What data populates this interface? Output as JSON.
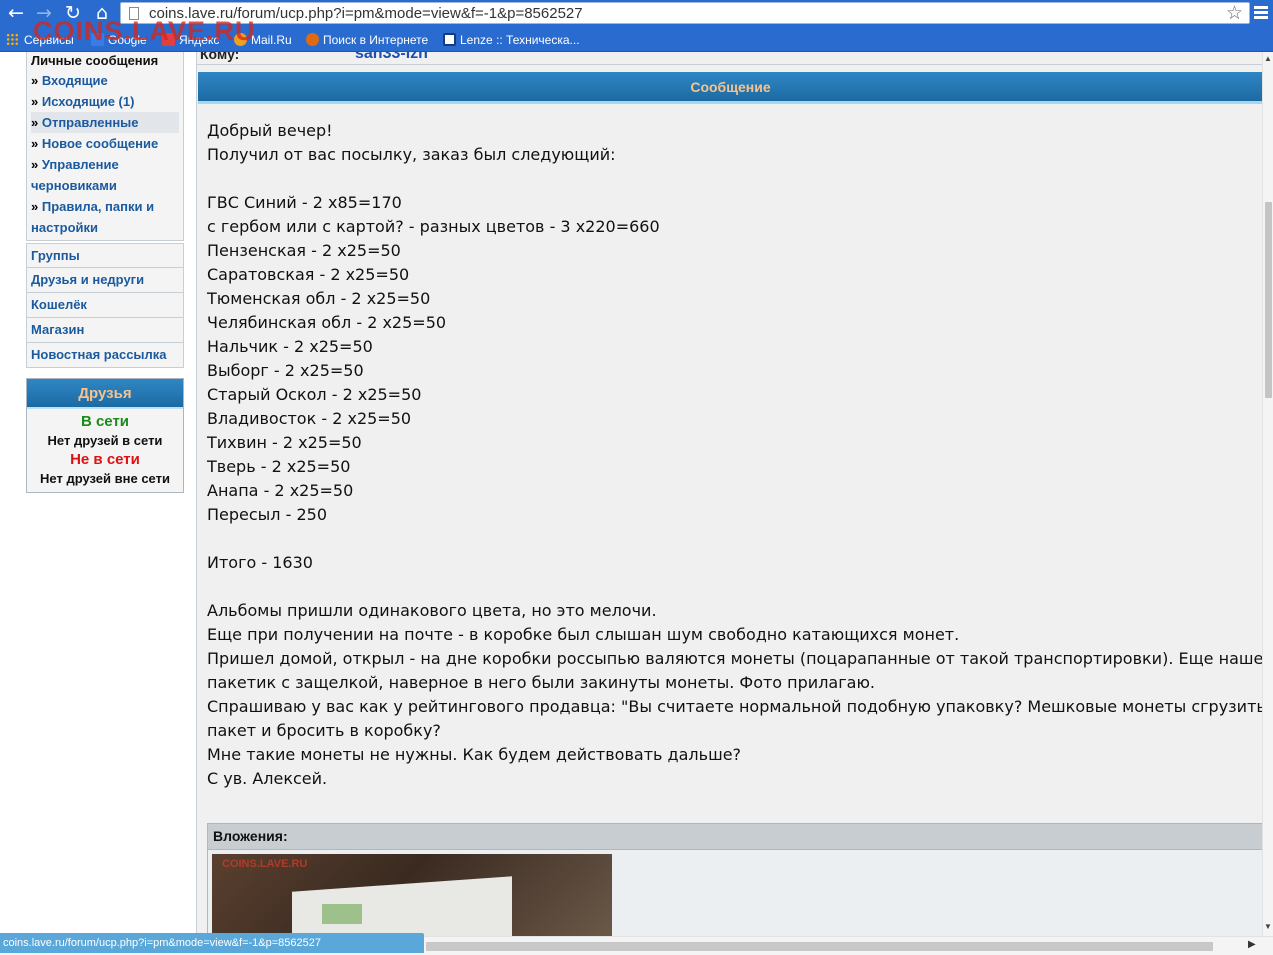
{
  "browser": {
    "url": "coins.lave.ru/forum/ucp.php?i=pm&mode=view&f=-1&p=8562527",
    "back_icon": "←",
    "forward_icon": "→",
    "reload_icon": "↻",
    "home_icon": "⌂",
    "star_icon": "☆",
    "watermark": "COINS.LAVE.RU",
    "bookmarks": [
      {
        "label": "Сервисы",
        "icon": "apps-icon",
        "color": "#ffb400"
      },
      {
        "label": "Google",
        "icon": "google-icon",
        "color": "#3b7be8"
      },
      {
        "label": "Яндекс",
        "icon": "yandex-icon",
        "color": "#e04040"
      },
      {
        "label": "Mail.Ru",
        "icon": "mailru-icon",
        "color": "#f0a020"
      },
      {
        "label": "Поиск в Интернете",
        "icon": "search-globe-icon",
        "color": "#e06a10"
      },
      {
        "label": "Lenze :: Техническа...",
        "icon": "lenze-icon",
        "color": "#1a3a80"
      }
    ],
    "status_url": "coins.lave.ru/forum/ucp.php?i=pm&mode=view&f=-1&p=8562527"
  },
  "sidebar": {
    "pm_title": "Личные сообщения",
    "pm_items": [
      {
        "label": "Входящие",
        "active": false
      },
      {
        "label": "Исходящие (1)",
        "active": false
      },
      {
        "label": "Отправленные",
        "active": true
      },
      {
        "label": "Новое сообщение",
        "active": false
      },
      {
        "label": "Управление черновиками",
        "active": false
      },
      {
        "label": "Правила, папки и настройки",
        "active": false
      }
    ],
    "links": [
      "Группы",
      "Друзья и недруги",
      "Кошелёк",
      "Магазин",
      "Новостная рассылка"
    ],
    "friends": {
      "title": "Друзья",
      "online_label": "В сети",
      "online_text": "Нет друзей в сети",
      "offline_label": "Не в сети",
      "offline_text": "Нет друзей вне сети"
    }
  },
  "message": {
    "to_label": "Кому:",
    "to_value": "sah33-lzh",
    "header": "Сообщение",
    "lines": [
      "Добрый вечер!",
      "Получил от вас посылку, заказ был следующий:",
      "",
      "ГВС Синий - 2 х85=170",
      "с гербом или с картой? - разных цветов - 3 х220=660",
      "Пензенская - 2 х25=50",
      "Саратовская - 2 х25=50",
      "Тюменская обл - 2 х25=50",
      "Челябинская обл - 2 х25=50",
      "Нальчик - 2 х25=50",
      "Выборг - 2 х25=50",
      "Старый Оскол - 2 х25=50",
      "Владивосток - 2 х25=50",
      "Тихвин - 2 х25=50",
      "Тверь - 2 х25=50",
      "Анапа - 2 х25=50",
      "Пересыл - 250",
      "",
      "Итого - 1630",
      "",
      "Альбомы пришли одинакового цвета, но это мелочи.",
      "Еще при получении на почте - в коробке был слышан шум свободно катающихся монет.",
      "Пришел домой, открыл - на дне коробки россыпью валяются монеты (поцарапанные от такой транспортировки). Еще нашел",
      "пакетик с защелкой, наверное в него были закинуты монеты. Фото прилагаю.",
      "Спрашиваю у вас как у рейтингового продавца: \"Вы считаете нормальной подобную упаковку? Мешковые монеты сгрузить в один",
      "пакет и бросить в коробку?",
      "Мне такие монеты не нужны. Как будем действовать дальше?",
      "С ув. Алексей."
    ],
    "attachments_label": "Вложения:",
    "photo_watermark": "COINS.LAVE.RU"
  }
}
